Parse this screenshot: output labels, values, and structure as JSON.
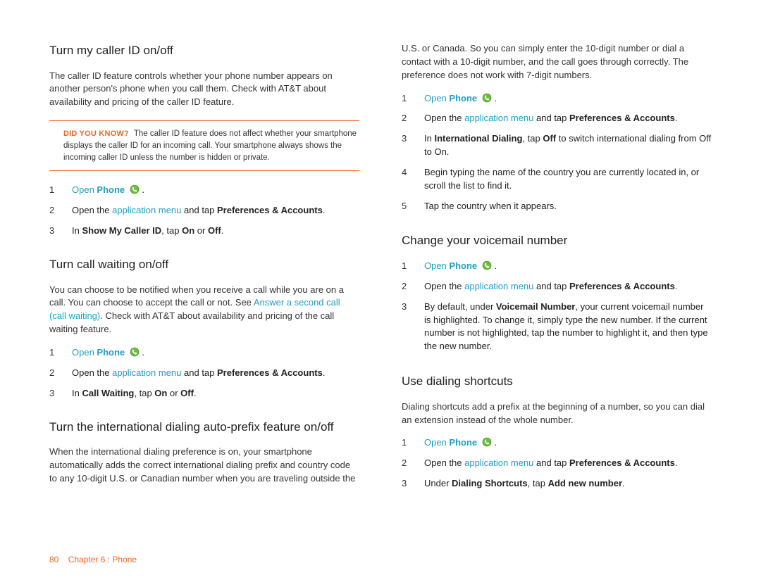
{
  "col1": {
    "h1": "Turn my caller ID on/off",
    "p1": "The caller ID feature controls whether your phone number appears on another person's phone when you call them. Check with AT&T about availability and pricing of the caller ID feature.",
    "callout_label": "DID YOU KNOW?",
    "callout_text": "The caller ID feature does not affect whether your smartphone displays the caller ID for an incoming call. Your smartphone always shows the incoming caller ID unless the number is hidden or private.",
    "stepsA": {
      "s1a": "Open ",
      "s1b": "Phone",
      "s1c": " .",
      "s2a": "Open the ",
      "s2link": "application menu",
      "s2b": " and tap ",
      "s2bold": "Preferences & Accounts",
      "s2c": ".",
      "s3a": "In ",
      "s3bold": "Show My Caller ID",
      "s3b": ", tap ",
      "s3on": "On",
      "s3c": " or ",
      "s3off": "Off",
      "s3d": "."
    },
    "h2": "Turn call waiting on/off",
    "p2a": "You can choose to be notified when you receive a call while you are on a call. You can choose to accept the call or not. See ",
    "p2link": "Answer a second call (call waiting)",
    "p2b": ". Check with AT&T about availability and pricing of the call waiting feature.",
    "stepsB": {
      "s1a": "Open ",
      "s1b": "Phone",
      "s1c": " .",
      "s2a": "Open the ",
      "s2link": "application menu",
      "s2b": " and tap ",
      "s2bold": "Preferences & Accounts",
      "s2c": ".",
      "s3a": "In ",
      "s3bold": "Call Waiting",
      "s3b": ", tap ",
      "s3on": "On",
      "s3c": " or ",
      "s3off": "Off",
      "s3d": "."
    },
    "h3": "Turn the international dialing auto-prefix feature on/off",
    "p3": "When the international dialing preference is on, your smartphone automatically adds the correct international dialing prefix and country code to any 10-digit U.S. or Canadian number when you are traveling outside the"
  },
  "col2": {
    "p_cont": "U.S. or Canada. So you can simply enter the 10-digit number or dial a contact with a 10-digit number, and the call goes through correctly. The preference does not work with 7-digit numbers.",
    "stepsC": {
      "s1a": "Open ",
      "s1b": "Phone",
      "s1c": " .",
      "s2a": "Open the ",
      "s2link": "application menu",
      "s2b": " and tap ",
      "s2bold": "Preferences & Accounts",
      "s2c": ".",
      "s3a": "In ",
      "s3bold": "International Dialing",
      "s3b": ", tap ",
      "s3off": "Off",
      "s3c": " to switch international dialing from Off to On.",
      "s4": "Begin typing the name of the country you are currently located in, or scroll the list to find it.",
      "s5": "Tap the country when it appears."
    },
    "h2": "Change your voicemail number",
    "stepsD": {
      "s1a": "Open ",
      "s1b": "Phone",
      "s1c": " .",
      "s2a": "Open the ",
      "s2link": "application menu",
      "s2b": " and tap ",
      "s2bold": "Preferences & Accounts",
      "s2c": ".",
      "s3a": "By default, under ",
      "s3bold": "Voicemail Number",
      "s3b": ", your current voicemail number is highlighted. To change it, simply type the new number. If the current number is not highlighted, tap the number to highlight it, and then type the new number."
    },
    "h3": "Use dialing shortcuts",
    "p3": "Dialing shortcuts add a prefix at the beginning of a number, so you can dial an extension instead of the whole number.",
    "stepsE": {
      "s1a": "Open ",
      "s1b": "Phone",
      "s1c": " .",
      "s2a": "Open the ",
      "s2link": "application menu",
      "s2b": " and tap ",
      "s2bold": "Preferences & Accounts",
      "s2c": ".",
      "s3a": "Under ",
      "s3bold": "Dialing Shortcuts",
      "s3b": ", tap ",
      "s3bold2": "Add new number",
      "s3c": "."
    }
  },
  "footer": {
    "page_num": "80",
    "chapter": "Chapter 6 : Phone"
  },
  "icons": {
    "phone": "phone-icon"
  }
}
